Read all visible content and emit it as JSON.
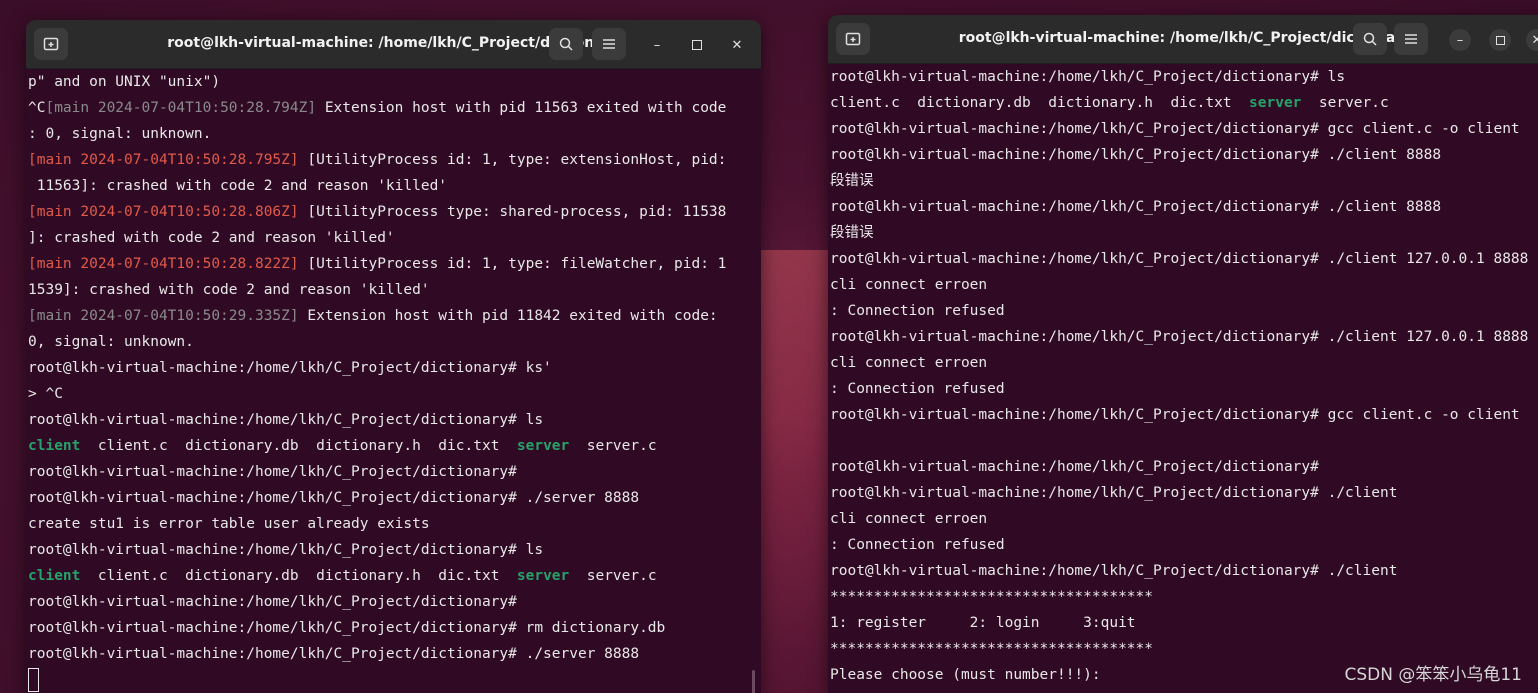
{
  "left_window": {
    "title": "root@lkh-virtual-machine: /home/lkh/C_Project/dictionary",
    "icons": {
      "new_tab": "new-tab-icon",
      "search": "search-icon",
      "menu": "hamburger-menu-icon",
      "minimize": "minimize-icon",
      "maximize": "maximize-icon",
      "close": "close-icon"
    },
    "lines": [
      [
        {
          "t": "p\" and on UNIX \"unix\")",
          "c": ""
        }
      ],
      [
        {
          "t": "^C",
          "c": ""
        },
        {
          "t": "[main 2024-07-04T10:50:28.794Z]",
          "c": "dim"
        },
        {
          "t": " Extension host with pid 11563 exited with code",
          "c": ""
        }
      ],
      [
        {
          "t": ": 0, signal: unknown.",
          "c": ""
        }
      ],
      [
        {
          "t": "[main 2024-07-04T10:50:28.795Z]",
          "c": "red"
        },
        {
          "t": " [UtilityProcess id: 1, type: extensionHost, pid:",
          "c": ""
        }
      ],
      [
        {
          "t": " 11563]: crashed with code 2 and reason 'killed'",
          "c": ""
        }
      ],
      [
        {
          "t": "[main 2024-07-04T10:50:28.806Z]",
          "c": "red"
        },
        {
          "t": " [UtilityProcess type: shared-process, pid: 11538",
          "c": ""
        }
      ],
      [
        {
          "t": "]: crashed with code 2 and reason 'killed'",
          "c": ""
        }
      ],
      [
        {
          "t": "[main 2024-07-04T10:50:28.822Z]",
          "c": "red"
        },
        {
          "t": " [UtilityProcess id: 1, type: fileWatcher, pid: 1",
          "c": ""
        }
      ],
      [
        {
          "t": "1539]: crashed with code 2 and reason 'killed'",
          "c": ""
        }
      ],
      [
        {
          "t": "[main 2024-07-04T10:50:29.335Z]",
          "c": "dim"
        },
        {
          "t": " Extension host with pid 11842 exited with code:",
          "c": ""
        }
      ],
      [
        {
          "t": "0, signal: unknown.",
          "c": ""
        }
      ],
      [
        {
          "t": "root@lkh-virtual-machine:/home/lkh/C_Project/dictionary# ks'",
          "c": ""
        }
      ],
      [
        {
          "t": "> ^C",
          "c": ""
        }
      ],
      [
        {
          "t": "root@lkh-virtual-machine:/home/lkh/C_Project/dictionary# ls",
          "c": ""
        }
      ],
      [
        {
          "t": "client",
          "c": "green"
        },
        {
          "t": "  client.c  dictionary.db  dictionary.h  dic.txt  ",
          "c": ""
        },
        {
          "t": "server",
          "c": "green"
        },
        {
          "t": "  server.c",
          "c": ""
        }
      ],
      [
        {
          "t": "root@lkh-virtual-machine:/home/lkh/C_Project/dictionary#",
          "c": ""
        }
      ],
      [
        {
          "t": "root@lkh-virtual-machine:/home/lkh/C_Project/dictionary# ./server 8888",
          "c": ""
        }
      ],
      [
        {
          "t": "create stu1 is error table user already exists",
          "c": ""
        }
      ],
      [
        {
          "t": "root@lkh-virtual-machine:/home/lkh/C_Project/dictionary# ls",
          "c": ""
        }
      ],
      [
        {
          "t": "client",
          "c": "green"
        },
        {
          "t": "  client.c  dictionary.db  dictionary.h  dic.txt  ",
          "c": ""
        },
        {
          "t": "server",
          "c": "green"
        },
        {
          "t": "  server.c",
          "c": ""
        }
      ],
      [
        {
          "t": "root@lkh-virtual-machine:/home/lkh/C_Project/dictionary#",
          "c": ""
        }
      ],
      [
        {
          "t": "root@lkh-virtual-machine:/home/lkh/C_Project/dictionary# rm dictionary.db",
          "c": ""
        }
      ],
      [
        {
          "t": "root@lkh-virtual-machine:/home/lkh/C_Project/dictionary# ./server 8888",
          "c": ""
        }
      ],
      [
        {
          "t": "",
          "c": "cursor"
        }
      ]
    ]
  },
  "right_window": {
    "title": "root@lkh-virtual-machine: /home/lkh/C_Project/dictionary",
    "icons": {
      "new_tab": "new-tab-icon",
      "search": "search-icon",
      "menu": "hamburger-menu-icon",
      "minimize": "minimize-icon",
      "maximize": "maximize-icon",
      "close": "close-icon"
    },
    "lines": [
      [
        {
          "t": "root@lkh-virtual-machine:/home/lkh/C_Project/dictionary# ls",
          "c": ""
        }
      ],
      [
        {
          "t": "client.c  dictionary.db  dictionary.h  dic.txt  ",
          "c": ""
        },
        {
          "t": "server",
          "c": "green"
        },
        {
          "t": "  server.c",
          "c": ""
        }
      ],
      [
        {
          "t": "root@lkh-virtual-machine:/home/lkh/C_Project/dictionary# gcc client.c -o client",
          "c": ""
        }
      ],
      [
        {
          "t": "root@lkh-virtual-machine:/home/lkh/C_Project/dictionary# ./client 8888",
          "c": ""
        }
      ],
      [
        {
          "t": "段错误",
          "c": ""
        }
      ],
      [
        {
          "t": "root@lkh-virtual-machine:/home/lkh/C_Project/dictionary# ./client 8888",
          "c": ""
        }
      ],
      [
        {
          "t": "段错误",
          "c": ""
        }
      ],
      [
        {
          "t": "root@lkh-virtual-machine:/home/lkh/C_Project/dictionary# ./client 127.0.0.1 8888",
          "c": ""
        }
      ],
      [
        {
          "t": "cli connect erroen",
          "c": ""
        }
      ],
      [
        {
          "t": ": Connection refused",
          "c": ""
        }
      ],
      [
        {
          "t": "root@lkh-virtual-machine:/home/lkh/C_Project/dictionary# ./client 127.0.0.1 8888",
          "c": ""
        }
      ],
      [
        {
          "t": "cli connect erroen",
          "c": ""
        }
      ],
      [
        {
          "t": ": Connection refused",
          "c": ""
        }
      ],
      [
        {
          "t": "root@lkh-virtual-machine:/home/lkh/C_Project/dictionary# gcc client.c -o client",
          "c": ""
        }
      ],
      [
        {
          "t": "",
          "c": ""
        }
      ],
      [
        {
          "t": "root@lkh-virtual-machine:/home/lkh/C_Project/dictionary#",
          "c": ""
        }
      ],
      [
        {
          "t": "root@lkh-virtual-machine:/home/lkh/C_Project/dictionary# ./client",
          "c": ""
        }
      ],
      [
        {
          "t": "cli connect erroen",
          "c": ""
        }
      ],
      [
        {
          "t": ": Connection refused",
          "c": ""
        }
      ],
      [
        {
          "t": "root@lkh-virtual-machine:/home/lkh/C_Project/dictionary# ./client",
          "c": ""
        }
      ],
      [
        {
          "t": "*************************************",
          "c": ""
        }
      ],
      [
        {
          "t": "1: register     2: login     3:quit",
          "c": ""
        }
      ],
      [
        {
          "t": "*************************************",
          "c": ""
        }
      ],
      [
        {
          "t": "Please choose (must number!!!):",
          "c": ""
        }
      ]
    ]
  },
  "watermark": "CSDN @笨笨小乌龟11"
}
